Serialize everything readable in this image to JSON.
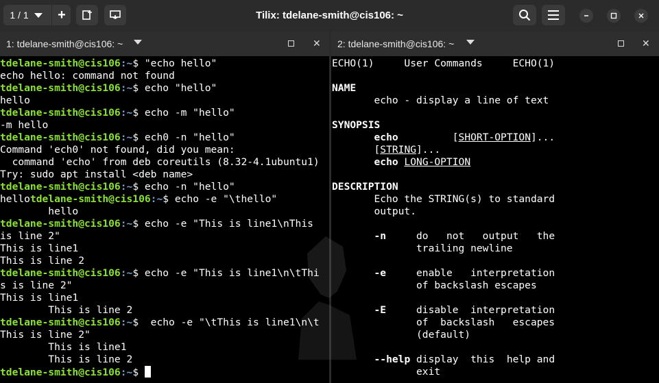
{
  "window": {
    "title": "Tilix: tdelane-smith@cis106: ~",
    "session_counter": "1 / 1"
  },
  "icons": {
    "session_dropdown": "chevron-down-icon",
    "add_terminal": "plus-icon",
    "new_session": "add-session-icon",
    "sync_input": "sync-input-icon",
    "search": "search-icon",
    "menu": "hamburger-menu-icon",
    "minimize": "minimize-icon",
    "maximize": "maximize-icon",
    "close": "close-icon"
  },
  "colors": {
    "prompt_user": "#8ae234",
    "prompt_path": "#729fcf",
    "terminal_bg": "#000000",
    "titlebar_bg": "#2b2b2b"
  },
  "left_pane": {
    "tab_label": "1: tdelane-smith@cis106: ~",
    "prompt_user": "tdelane-smith@cis106",
    "prompt_path": ":~",
    "prompt_symbol": "$",
    "lines": [
      {
        "type": "prompt",
        "cmd": " \"echo hello\""
      },
      {
        "type": "out",
        "text": "echo hello: command not found"
      },
      {
        "type": "prompt",
        "cmd": " echo \"hello\""
      },
      {
        "type": "out",
        "text": "hello"
      },
      {
        "type": "prompt",
        "cmd": " echo -m \"hello\""
      },
      {
        "type": "out",
        "text": "-m hello"
      },
      {
        "type": "prompt",
        "cmd": " ech0 -n \"hello\""
      },
      {
        "type": "out",
        "text": "Command 'ech0' not found, did you mean:"
      },
      {
        "type": "out",
        "text": "  command 'echo' from deb coreutils (8.32-4.1ubuntu1)"
      },
      {
        "type": "out",
        "text": "Try: sudo apt install <deb name>"
      },
      {
        "type": "prompt",
        "cmd": " echo -n \"hello\""
      },
      {
        "type": "prompt",
        "pre": "hello",
        "cmd": " echo -e \"\\thello\""
      },
      {
        "type": "out",
        "text": "        hello"
      },
      {
        "type": "prompt",
        "cmd": " echo -e \"This is line1\\nThis"
      },
      {
        "type": "out",
        "text": "is line 2\""
      },
      {
        "type": "out",
        "text": "This is line1"
      },
      {
        "type": "out",
        "text": "This is line 2"
      },
      {
        "type": "prompt",
        "cmd": " echo -e \"This is line1\\n\\tThi"
      },
      {
        "type": "out",
        "text": "s is line 2\""
      },
      {
        "type": "out",
        "text": "This is line1"
      },
      {
        "type": "out",
        "text": "        This is line 2"
      },
      {
        "type": "prompt",
        "cmd": "  echo -e \"\\tThis is line1\\n\\t"
      },
      {
        "type": "out",
        "text": "This is line 2\""
      },
      {
        "type": "out",
        "text": "        This is line1"
      },
      {
        "type": "out",
        "text": "        This is line 2"
      },
      {
        "type": "prompt",
        "cmd": " ",
        "cursor": true
      }
    ]
  },
  "right_pane": {
    "tab_label": "2: tdelane-smith@cis106: ~",
    "lines": [
      [
        {
          "t": "ECHO(1)     User Commands     ECHO(1)"
        }
      ],
      [
        {
          "t": ""
        }
      ],
      [
        {
          "t": "NAME",
          "s": "bold"
        }
      ],
      [
        {
          "t": "       echo - display a line of text"
        }
      ],
      [
        {
          "t": ""
        }
      ],
      [
        {
          "t": "SYNOPSIS",
          "s": "bold"
        }
      ],
      [
        {
          "t": "       "
        },
        {
          "t": "echo",
          "s": "bold"
        },
        {
          "t": "         ["
        },
        {
          "t": "SHORT-OPTION",
          "s": "u"
        },
        {
          "t": "]..."
        }
      ],
      [
        {
          "t": "       ["
        },
        {
          "t": "STRING",
          "s": "u"
        },
        {
          "t": "]..."
        }
      ],
      [
        {
          "t": "       "
        },
        {
          "t": "echo",
          "s": "bold"
        },
        {
          "t": " "
        },
        {
          "t": "LONG-OPTION",
          "s": "u"
        }
      ],
      [
        {
          "t": ""
        }
      ],
      [
        {
          "t": "DESCRIPTION",
          "s": "bold"
        }
      ],
      [
        {
          "t": "       Echo the STRING(s) to standard"
        }
      ],
      [
        {
          "t": "       output."
        }
      ],
      [
        {
          "t": ""
        }
      ],
      [
        {
          "t": "       "
        },
        {
          "t": "-n",
          "s": "bold"
        },
        {
          "t": "     do   not   output   the"
        }
      ],
      [
        {
          "t": "              trailing newline"
        }
      ],
      [
        {
          "t": ""
        }
      ],
      [
        {
          "t": "       "
        },
        {
          "t": "-e",
          "s": "bold"
        },
        {
          "t": "     enable   interpretation"
        }
      ],
      [
        {
          "t": "              of backslash escapes"
        }
      ],
      [
        {
          "t": ""
        }
      ],
      [
        {
          "t": "       "
        },
        {
          "t": "-E",
          "s": "bold"
        },
        {
          "t": "     disable  interpretation"
        }
      ],
      [
        {
          "t": "              of  backslash   escapes"
        }
      ],
      [
        {
          "t": "              (default)"
        }
      ],
      [
        {
          "t": ""
        }
      ],
      [
        {
          "t": "       "
        },
        {
          "t": "--help",
          "s": "bold"
        },
        {
          "t": " display  this  help and"
        }
      ],
      [
        {
          "t": "              exit"
        }
      ]
    ]
  }
}
